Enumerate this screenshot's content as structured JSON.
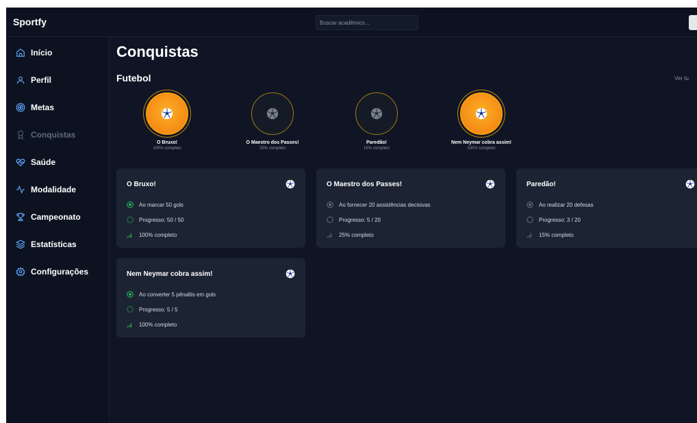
{
  "app": {
    "brand": "Sportfy"
  },
  "search": {
    "placeholder": "Buscar acadêmico..."
  },
  "sidebar": {
    "items": [
      {
        "label": "Início",
        "icon": "home-icon"
      },
      {
        "label": "Perfil",
        "icon": "user-icon"
      },
      {
        "label": "Metas",
        "icon": "target-icon"
      },
      {
        "label": "Conquistas",
        "icon": "award-icon",
        "active": true
      },
      {
        "label": "Saúde",
        "icon": "heart-pulse-icon"
      },
      {
        "label": "Modalidade",
        "icon": "activity-icon"
      },
      {
        "label": "Campeonato",
        "icon": "trophy-icon"
      },
      {
        "label": "Estatísticas",
        "icon": "layers-icon"
      },
      {
        "label": "Configurações",
        "icon": "gear-icon"
      }
    ]
  },
  "main": {
    "title": "Conquistas",
    "section": {
      "title": "Futebol",
      "see_all": "Ver tu"
    },
    "badges": [
      {
        "name": "O Bruxo!",
        "percent_text": "100% completo",
        "progress": 1.0
      },
      {
        "name": "O Maestro dos Passes!",
        "percent_text": "25% completo",
        "progress": 0.25
      },
      {
        "name": "Paredão!",
        "percent_text": "15% completo",
        "progress": 0.15
      },
      {
        "name": "Nem Neymar cobra assim!",
        "percent_text": "100% completo",
        "progress": 1.0
      }
    ],
    "cards": [
      {
        "title": "O Bruxo!",
        "goal": "Ao marcar 50 gols",
        "progress": "Progresso: 50 / 50",
        "percent": "100% completo",
        "complete": true
      },
      {
        "title": "O Maestro dos Passes!",
        "goal": "Ao fornecer 20 assistências decisivas",
        "progress": "Progresso: 5 / 20",
        "percent": "25% completo",
        "complete": false
      },
      {
        "title": "Paredão!",
        "goal": "Ao realizar 20 defesas",
        "progress": "Progresso: 3 / 20",
        "percent": "15% completo",
        "complete": false
      },
      {
        "title": "Nem Neymar cobra assim!",
        "goal": "Ao converter 5 pênaltis em gols",
        "progress": "Progresso: 5 / 5",
        "percent": "100% completo",
        "complete": true
      }
    ]
  },
  "colors": {
    "background": "#0f1524",
    "sidebar": "#0c1220",
    "card": "#1c2433",
    "accent_blue": "#60a5fa",
    "gold": "#f59e0b",
    "success_green": "#22c55e"
  }
}
